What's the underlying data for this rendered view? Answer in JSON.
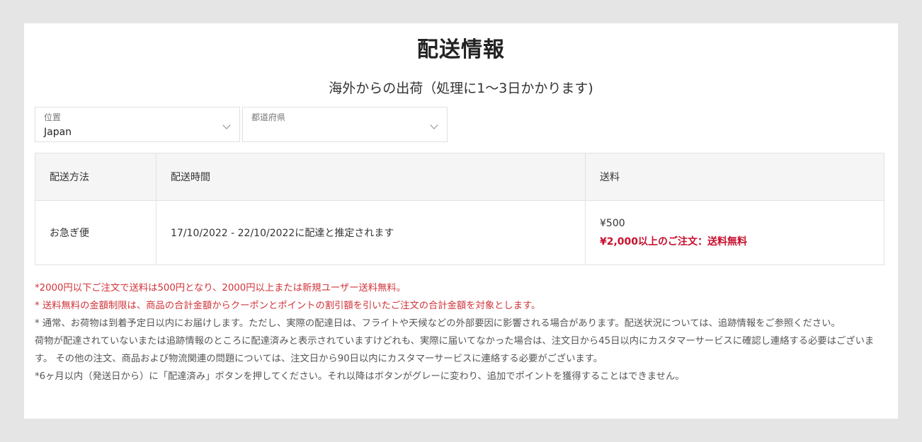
{
  "page": {
    "title": "配送情報",
    "subtitle": "海外からの出荷（処理に1～3日かかります)"
  },
  "filters": {
    "location": {
      "label": "位置",
      "value": "Japan"
    },
    "prefecture": {
      "label": "都道府県",
      "value": ""
    }
  },
  "table": {
    "headers": [
      "配送方法",
      "配送時間",
      "送料"
    ],
    "rows": [
      {
        "method": "お急ぎ便",
        "time": "17/10/2022 - 22/10/2022に配達と推定されます",
        "fee": "¥500",
        "free_note": "¥2,000以上のご注文：送料無料"
      }
    ]
  },
  "notes": [
    {
      "text": "*2000円以下ご注文で送料は500円となり、2000円以上または新規ユーザー送料無料。",
      "color": "red"
    },
    {
      "text": "* 送料無料の金額制限は、商品の合計金額からクーポンとポイントの割引額を引いたご注文の合計金額を対象とします。",
      "color": "red"
    },
    {
      "text": "* 通常、お荷物は到着予定日以内にお届けします。ただし、実際の配達日は、フライトや天候などの外部要因に影響される場合があります。配送状況については、追跡情報をご参照ください。",
      "color": "gray"
    },
    {
      "text": "荷物が配達されていないまたは追跡情報のところに配達済みと表示されていますけどれも、実際に届いてなかった場合は、注文日から45日以内にカスタマーサービスに確認し連絡する必要はございます。 その他の注文、商品および物流関連の問題については、注文日から90日以内にカスタマーサービスに連絡する必要がございます。",
      "color": "gray"
    },
    {
      "text": "*6ヶ月以内（発送日から）に「配達済み」ボタンを押してください。それ以降はボタンがグレーに変わり、追加でポイントを獲得することはできません。",
      "color": "gray"
    }
  ],
  "colors": {
    "accent_red": "#c8102e",
    "page_bg": "#e5e5e5"
  }
}
